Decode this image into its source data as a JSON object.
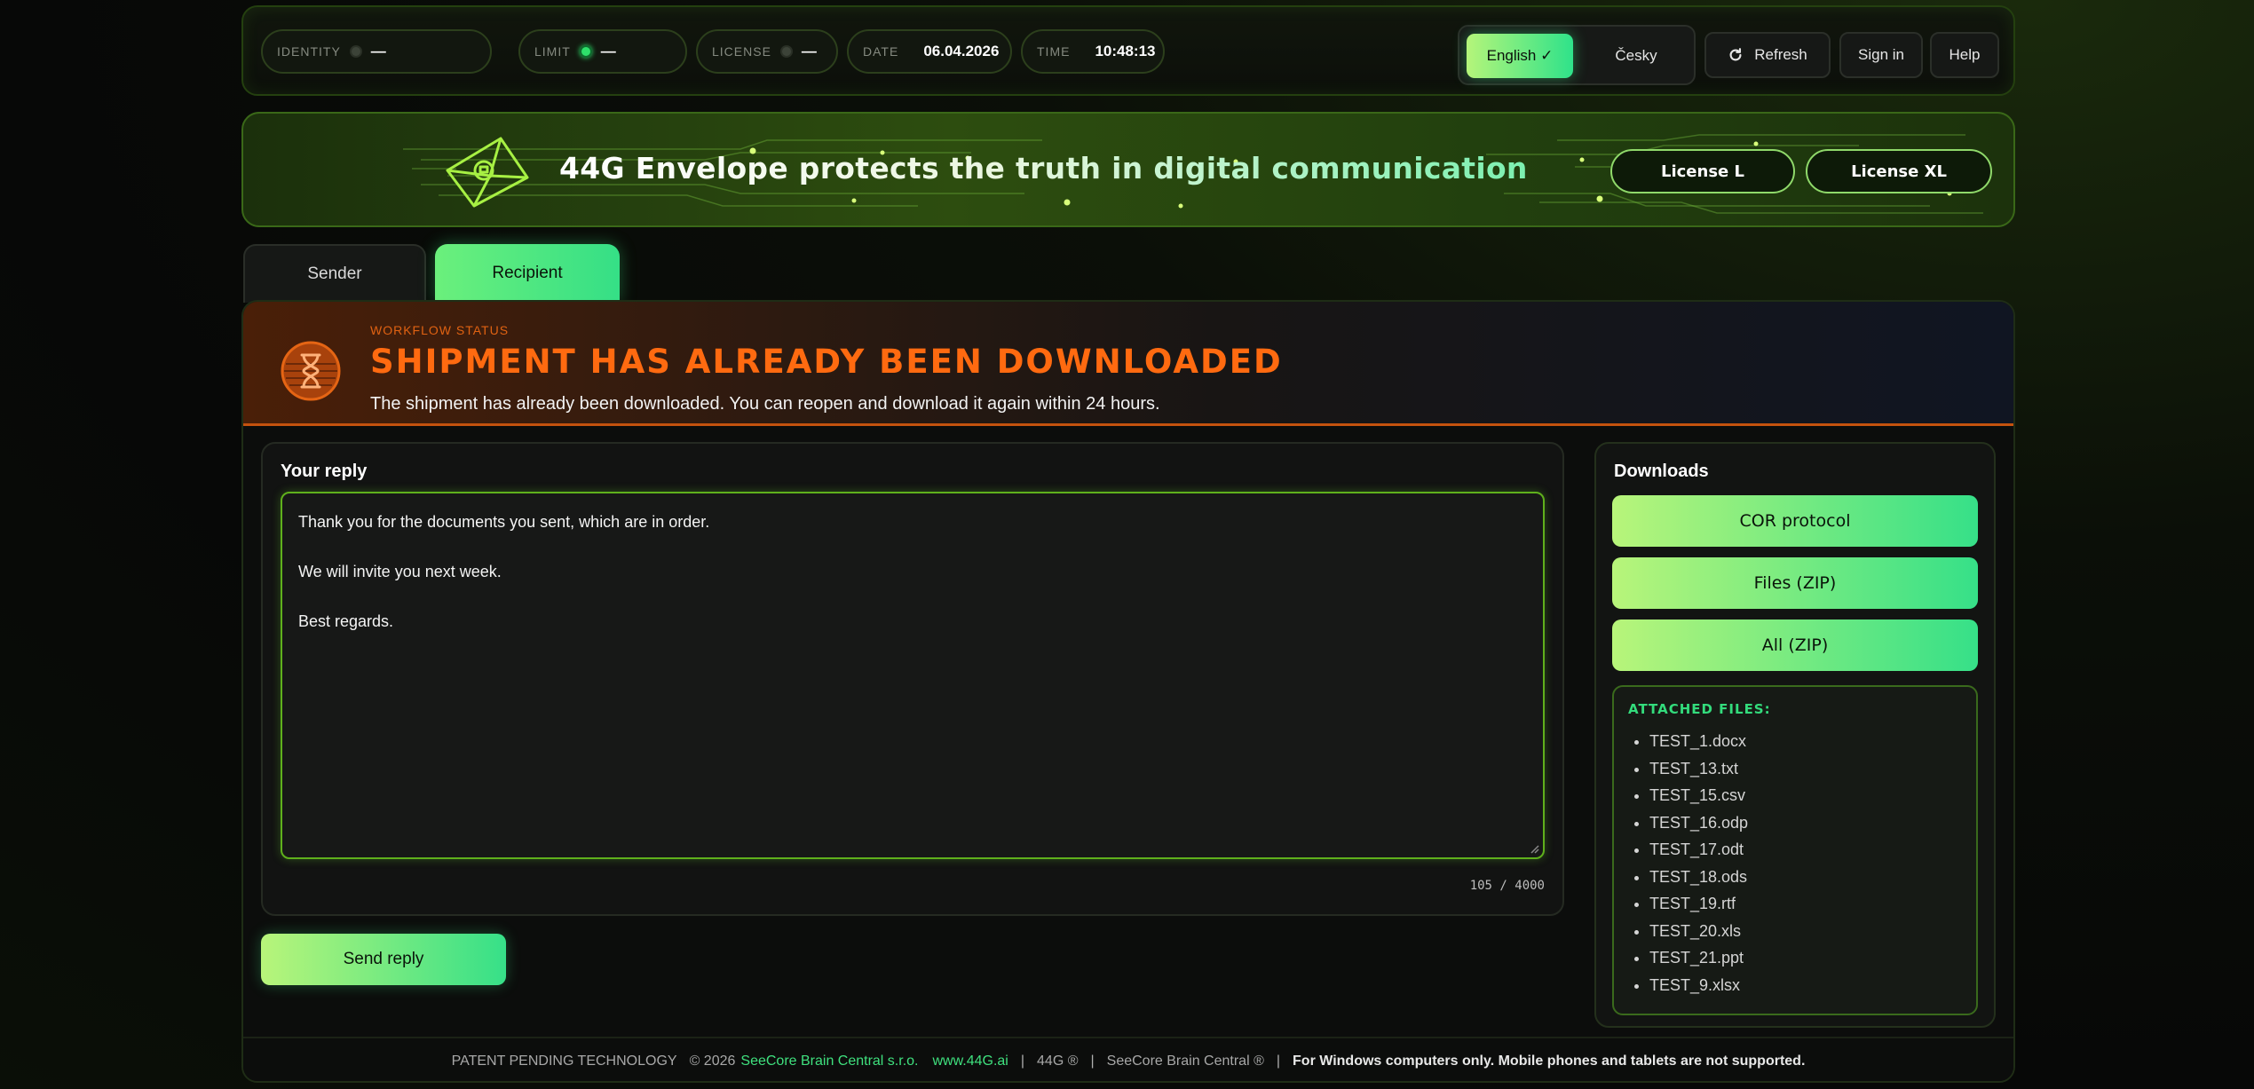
{
  "topbar": {
    "identity": {
      "label": "IDENTITY",
      "value": "—",
      "active": false
    },
    "limit": {
      "label": "LIMIT",
      "value": "—",
      "active": true
    },
    "license": {
      "label": "LICENSE",
      "value": "—",
      "active": false
    },
    "date": {
      "label": "DATE",
      "value": "06.04.2026"
    },
    "time": {
      "label": "TIME",
      "value": "10:48:13"
    },
    "languages": {
      "english": "English ✓",
      "czech": "Česky"
    },
    "refresh_label": "Refresh",
    "signin_label": "Sign in",
    "help_label": "Help"
  },
  "banner": {
    "title": "44G Envelope protects the truth in digital communication",
    "license_l": "License L",
    "license_xl": "License XL"
  },
  "tabs": [
    {
      "label": "Sender",
      "active": false
    },
    {
      "label": "Recipient",
      "active": true
    }
  ],
  "status": {
    "kicker": "WORKFLOW STATUS",
    "title": "SHIPMENT HAS ALREADY BEEN DOWNLOADED",
    "description": "The shipment has already been downloaded. You can reopen and download it again within 24 hours."
  },
  "reply": {
    "title": "Your reply",
    "lines": [
      "Thank you for the documents you sent, which are in order.",
      "We will invite you next week.",
      "Best regards."
    ],
    "counter": "105 / 4000",
    "send_label": "Send reply"
  },
  "downloads": {
    "title": "Downloads",
    "buttons": [
      "COR protocol",
      "Files (ZIP)",
      "All (ZIP)"
    ],
    "attached_title": "ATTACHED FILES:",
    "files": [
      "TEST_1.docx",
      "TEST_13.txt",
      "TEST_15.csv",
      "TEST_16.odp",
      "TEST_17.odt",
      "TEST_18.ods",
      "TEST_19.rtf",
      "TEST_20.xls",
      "TEST_21.ppt",
      "TEST_9.xlsx"
    ]
  },
  "footer": {
    "patent": "PATENT PENDING TECHNOLOGY",
    "copyright": "© 2026",
    "company": "SeeCore Brain Central s.r.o.",
    "website": "www.44G.ai",
    "brand1": "44G ®",
    "brand2": "SeeCore Brain Central ®",
    "notice": "For Windows computers only. Mobile phones and tablets are not supported."
  },
  "colors": {
    "accent_green": "#36e088",
    "accent_lime": "#b8f57a",
    "status_orange": "#ff6a10",
    "border_green": "#5fb01c"
  },
  "icons": {
    "refresh": "refresh-icon",
    "envelope_logo": "envelope-logo-icon",
    "hourglass": "hourglass-icon"
  }
}
